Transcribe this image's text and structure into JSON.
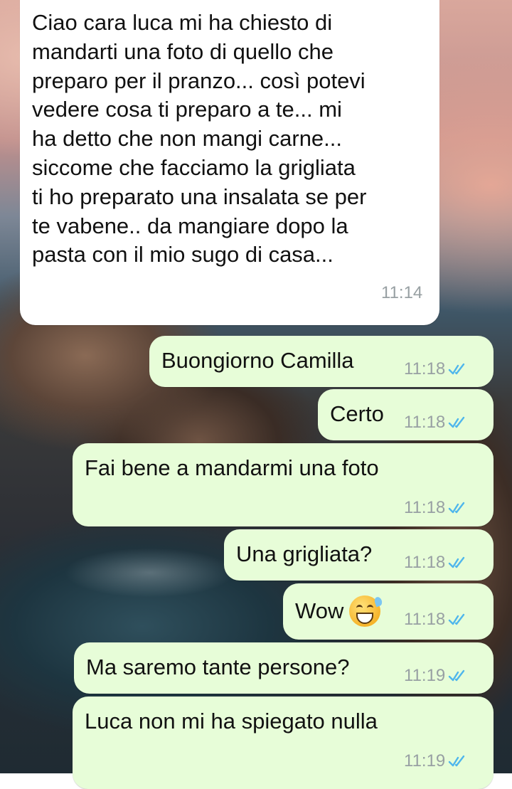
{
  "messages": [
    {
      "direction": "incoming",
      "text": "Ciao cara luca mi ha chiesto di\nmandarti una foto di quello che\npreparo per il pranzo... così potevi\nvedere cosa ti preparo a te... mi\nha detto che non mangi carne...\nsiccome che facciamo la grigliata\nti ho preparato una insalata se per\nte vabene.. da mangiare dopo la\npasta con il mio sugo di casa...",
      "time": "11:14"
    },
    {
      "direction": "outgoing",
      "text": "Buongiorno Camilla",
      "time": "11:18",
      "status": "read"
    },
    {
      "direction": "outgoing",
      "text": "Certo",
      "time": "11:18",
      "status": "read"
    },
    {
      "direction": "outgoing",
      "text": "Fai bene a mandarmi una foto",
      "time": "11:18",
      "status": "read"
    },
    {
      "direction": "outgoing",
      "text": "Una grigliata?",
      "time": "11:18",
      "status": "read"
    },
    {
      "direction": "outgoing",
      "text": "Wow",
      "emoji": "grinning-sweat-emoji",
      "time": "11:18",
      "status": "read"
    },
    {
      "direction": "outgoing",
      "text": "Ma saremo tante persone?",
      "time": "11:19",
      "status": "read"
    },
    {
      "direction": "outgoing",
      "text": "Luca non mi ha spiegato nulla",
      "time": "11:19",
      "status": "read"
    }
  ],
  "colors": {
    "incoming_bubble": "#ffffff",
    "outgoing_bubble": "#e7fdd8",
    "timestamp": "#98a0a3",
    "read_ticks": "#4fb6ec"
  }
}
